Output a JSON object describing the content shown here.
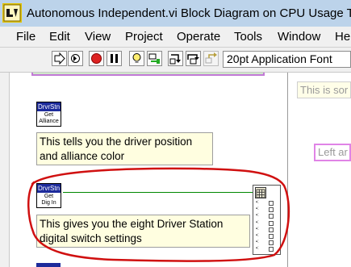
{
  "window": {
    "title": "Autonomous Independent.vi Block Diagram on CPU Usage Te"
  },
  "menu": [
    "File",
    "Edit",
    "View",
    "Project",
    "Operate",
    "Tools",
    "Window",
    "He"
  ],
  "toolbar": {
    "font_select": "20pt Application Font",
    "buttons": [
      "run-arrow-icon",
      "run-continuously-icon",
      "abort-icon",
      "pause-icon",
      "highlight-execution-icon",
      "retain-wire-values-icon",
      "step-into-icon",
      "step-over-icon",
      "step-out-icon"
    ]
  },
  "diagram": {
    "node_get_alliance": {
      "header": "DrvrStn",
      "line1": "Get",
      "line2": "Alliance"
    },
    "node_get_dig_in": {
      "header": "DrvrStn",
      "line1": "Get",
      "line2": "Dig In"
    },
    "comment_alliance": "This tells you the driver position and alliance color",
    "comment_dig_in": "This gives you the eight Driver Station digital switch settings",
    "right_comment_top": "This is sor",
    "right_comment_bottom": "Left ar",
    "bool_array_count": 8,
    "annotation_color": "#d01010",
    "wire_color": "#008800",
    "node_header_color": "#1d2b9b"
  }
}
